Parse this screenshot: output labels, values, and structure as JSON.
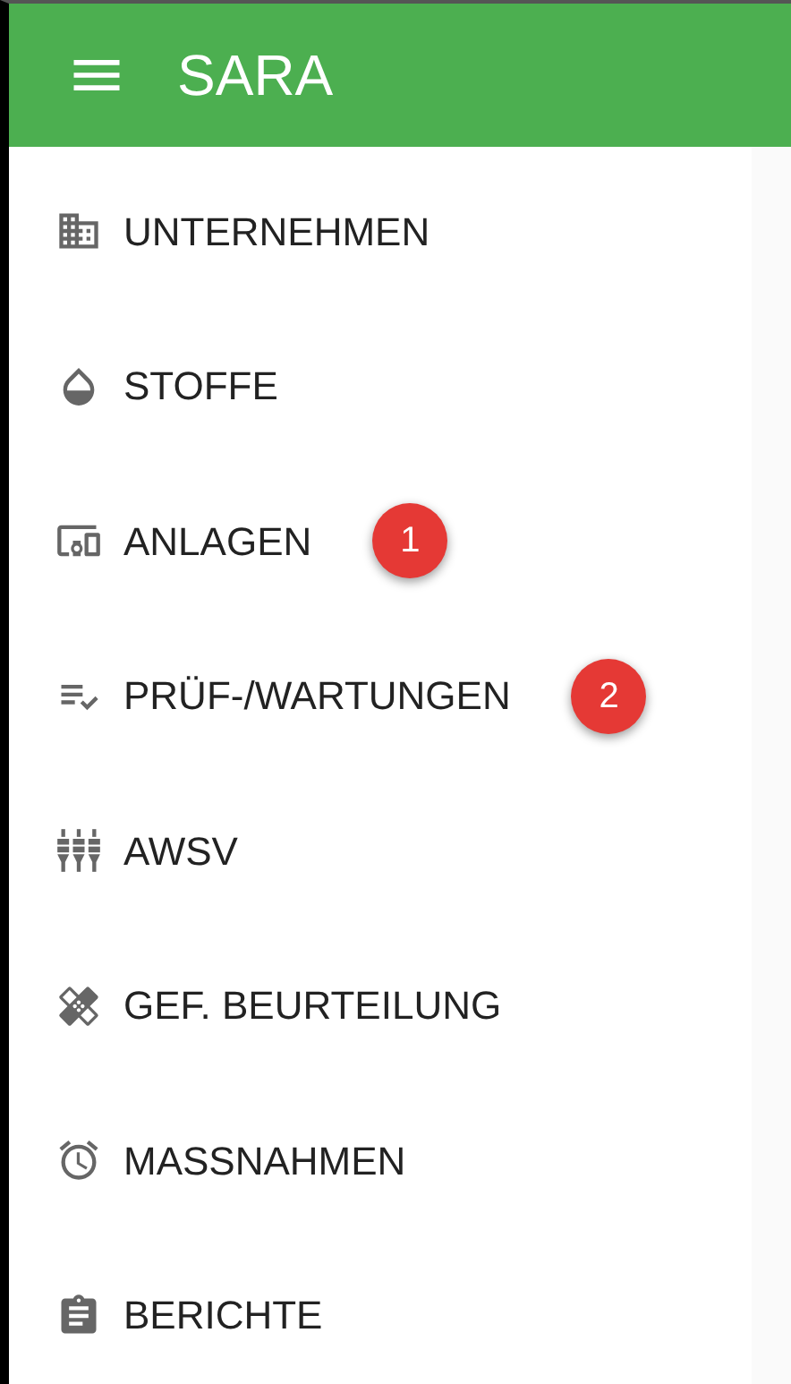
{
  "app_bar": {
    "title": "SARA"
  },
  "menu": [
    {
      "label": "UNTERNEHMEN"
    },
    {
      "label": "STOFFE"
    },
    {
      "label": "ANLAGEN",
      "badge": "1"
    },
    {
      "label": "PRÜF-/WARTUNGEN",
      "badge": "2"
    },
    {
      "label": "AWSV"
    },
    {
      "label": "GEF. BEURTEILUNG"
    },
    {
      "label": "MASSNAHMEN"
    },
    {
      "label": "BERICHTE"
    }
  ]
}
